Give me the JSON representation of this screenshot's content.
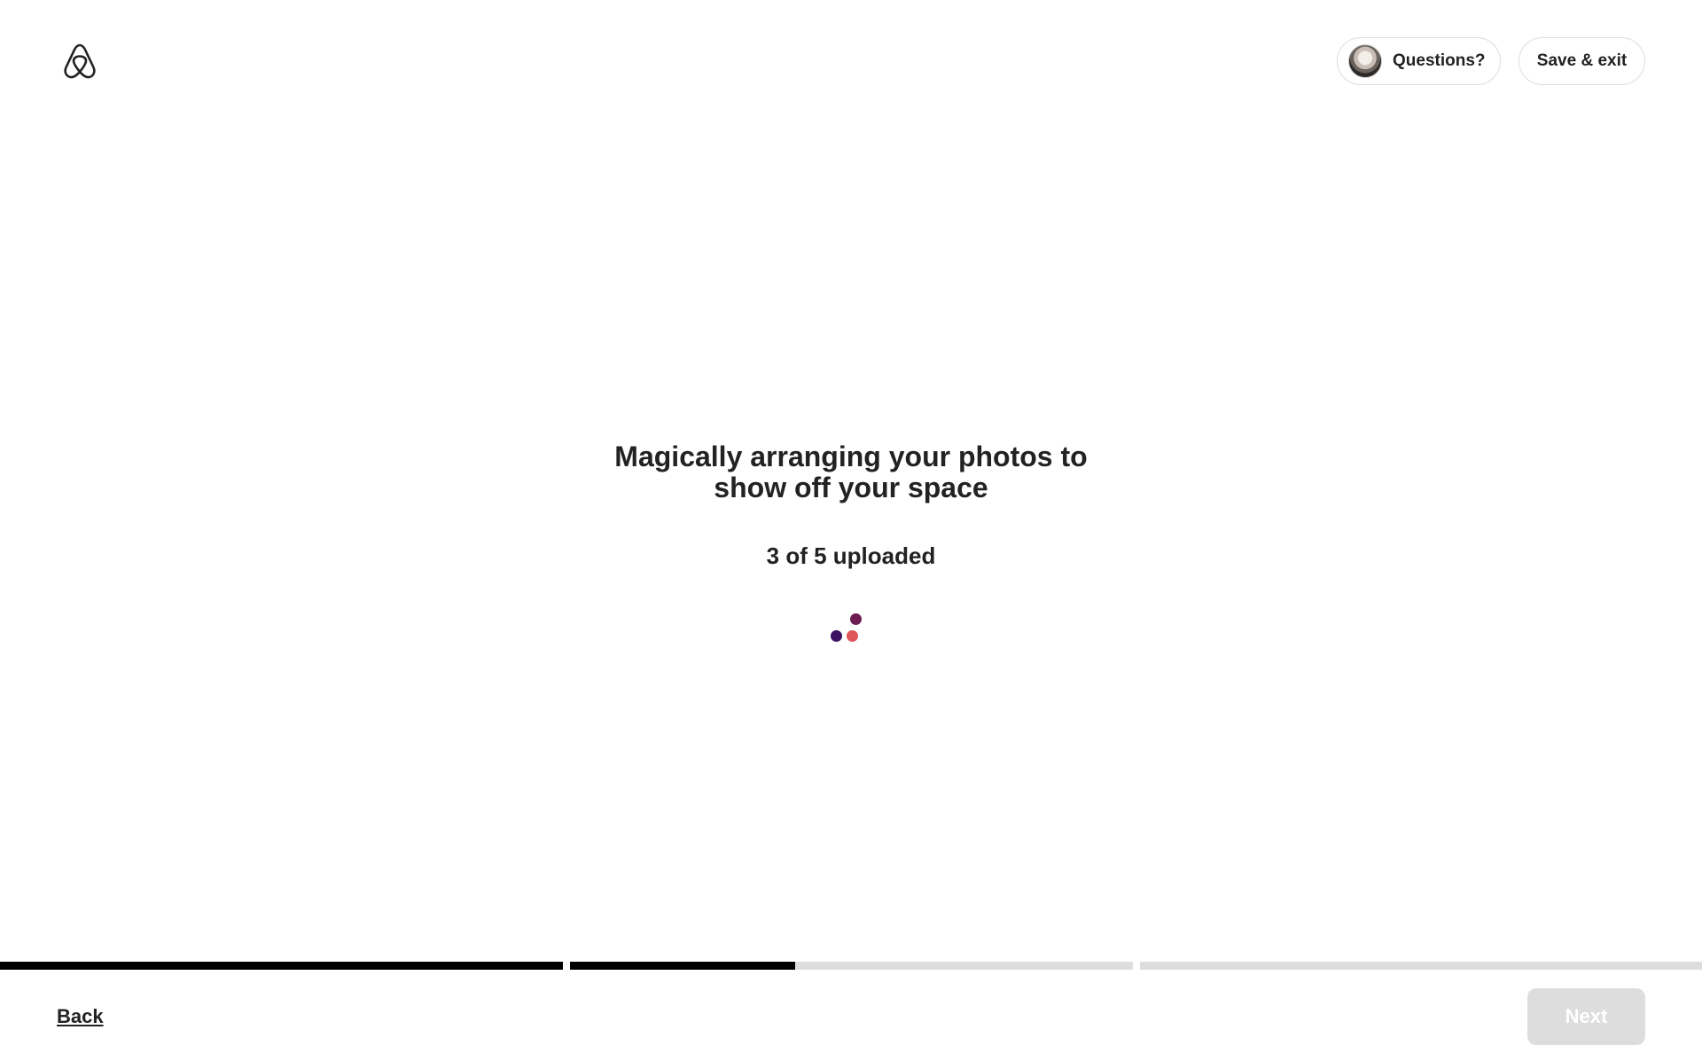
{
  "header": {
    "questions_label": "Questions?",
    "save_exit_label": "Save & exit"
  },
  "main": {
    "headline": "Magically arranging your photos to show off your space",
    "status": "3 of 5 uploaded",
    "uploaded_count": 3,
    "total_count": 5,
    "loader_colors": [
      "#6b1e4f",
      "#3d1361",
      "#e0565b"
    ]
  },
  "progress": {
    "segments": [
      {
        "fill": 1.0
      },
      {
        "fill": 0.4
      },
      {
        "fill": 0.0
      }
    ]
  },
  "footer": {
    "back_label": "Back",
    "next_label": "Next",
    "next_enabled": false
  },
  "colors": {
    "text": "#222222",
    "border": "#dddddd",
    "disabled_button": "#dddddd",
    "progress_fill": "#000000",
    "progress_track": "#dddddd"
  }
}
